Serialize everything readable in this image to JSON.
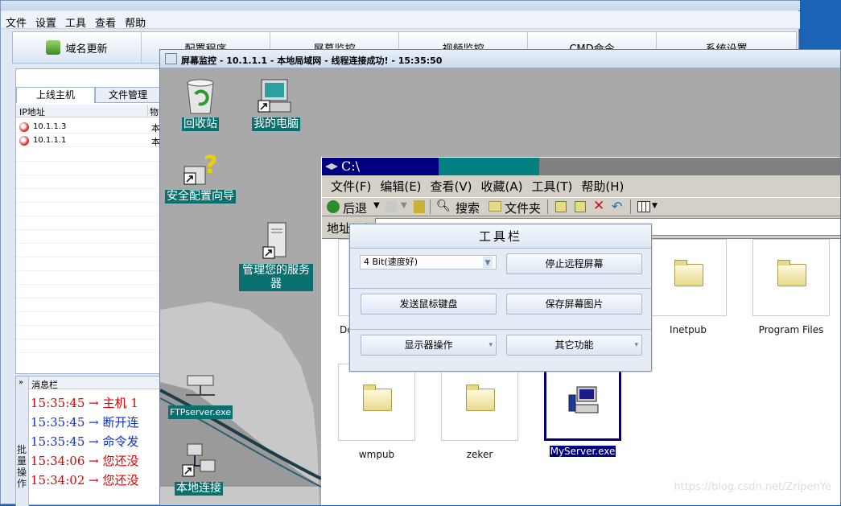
{
  "main_window": {
    "menu": [
      "文件",
      "设置",
      "工具",
      "查看",
      "帮助"
    ],
    "toolbar": [
      "域名更新",
      "配置程序",
      "屏幕监控",
      "视频监控",
      "CMD命令",
      "系统设置"
    ]
  },
  "left_panel": {
    "tabs": [
      "上线主机",
      "文件管理"
    ],
    "columns": [
      "IP地址",
      "物"
    ],
    "hosts": [
      {
        "ip": "10.1.1.3",
        "col2": "本"
      },
      {
        "ip": "10.1.1.1",
        "col2": "本"
      }
    ]
  },
  "message_panel": {
    "side_label": "批量操作",
    "header": "消息栏",
    "messages": [
      {
        "text": "15:35:45 → 主机 1",
        "color": "#e00000"
      },
      {
        "text": "15:35:45 → 断开连",
        "color": "#1030d0"
      },
      {
        "text": "15:35:45 → 命令发",
        "color": "#1030d0"
      },
      {
        "text": "15:34:06 → 您还没",
        "color": "#e00000"
      },
      {
        "text": "15:34:02 → 您还没",
        "color": "#e00000"
      }
    ]
  },
  "monitor_window": {
    "title": "屏幕监控 - 10.1.1.1 - 本地局域网 - 线程连接成功! - 15:35:50"
  },
  "desktop_icons": [
    "回收站",
    "我的电脑",
    "安全配置向导",
    "管理您的服务器",
    "FTPserver.exe",
    "本地连接"
  ],
  "explorer": {
    "title": "C:\\",
    "menu": [
      "文件(F)",
      "编辑(E)",
      "查看(V)",
      "收藏(A)",
      "工具(T)",
      "帮助(H)"
    ],
    "toolbar": {
      "back": "后退",
      "search": "搜索",
      "folders": "文件夹"
    },
    "address_label": "地址(D)",
    "items": [
      "Do",
      "Inetpub",
      "Program Files",
      "wmpub",
      "zeker",
      "MyServer.exe"
    ]
  },
  "tool_panel": {
    "title": "工具栏",
    "color_select": "4 Bit(速度好)",
    "buttons": [
      "停止远程屏幕",
      "发送鼠标键盘",
      "保存屏幕图片",
      "显示器操作",
      "其它功能"
    ]
  },
  "watermark": "https://blog.csdn.net/ZripenYe",
  "colors": {
    "teal_label": "#0a6f6f",
    "navy_title": "#000080",
    "msg_red": "#e00000",
    "msg_blue": "#1030d0"
  }
}
